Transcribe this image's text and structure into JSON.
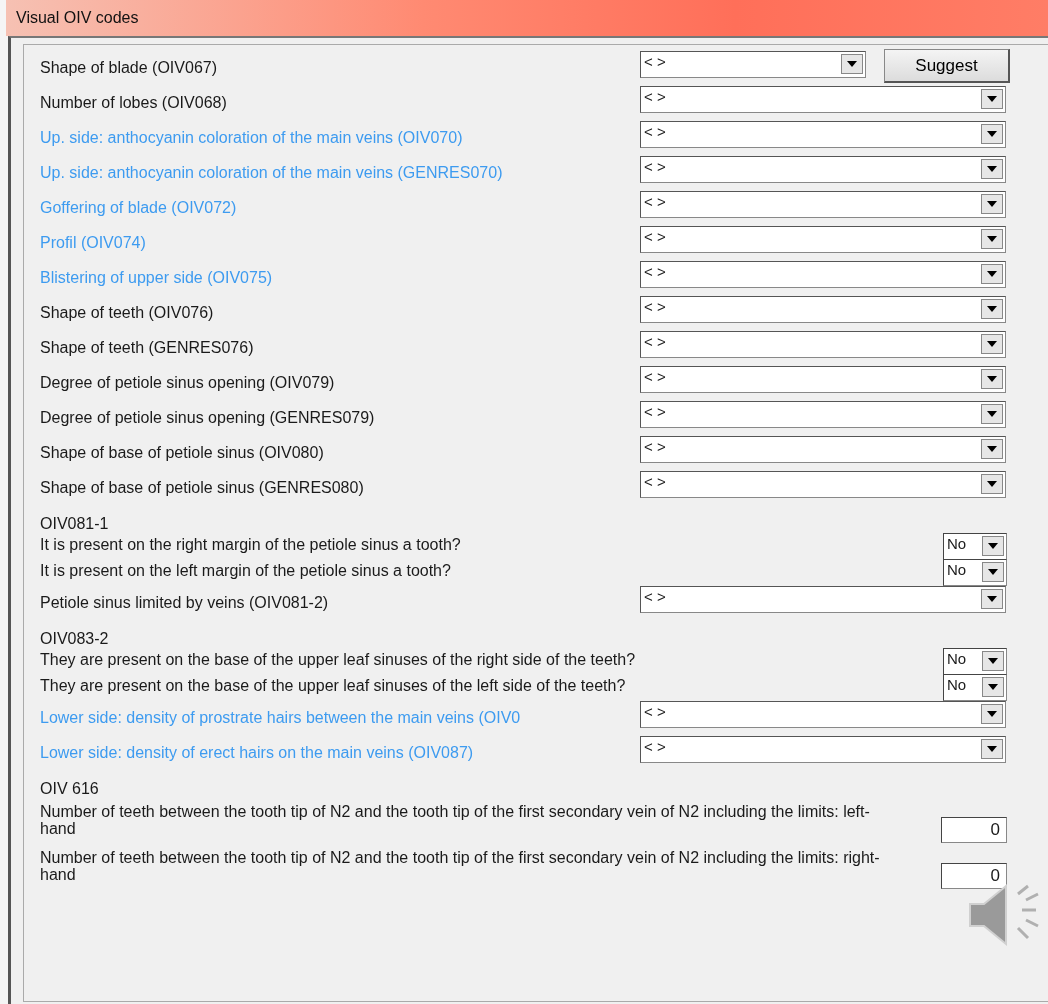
{
  "window": {
    "title": "Visual OIV codes"
  },
  "items": [
    {
      "kind": "select",
      "label": "Shape of blade (OIV067)",
      "highlighted": false,
      "value": "< >",
      "button": "Suggest"
    },
    {
      "kind": "select",
      "label": "Number of lobes (OIV068)",
      "highlighted": false,
      "value": "< >"
    },
    {
      "kind": "select",
      "label": "Up. side: anthocyanin coloration of the main veins (OIV070)",
      "highlighted": true,
      "value": "< >"
    },
    {
      "kind": "select",
      "label": "Up. side: anthocyanin coloration of the main veins (GENRES070)",
      "highlighted": true,
      "value": "< >"
    },
    {
      "kind": "select",
      "label": "Goffering of blade (OIV072)",
      "highlighted": true,
      "value": "< >"
    },
    {
      "kind": "select",
      "label": "Profil (OIV074)",
      "highlighted": true,
      "value": "< >"
    },
    {
      "kind": "select",
      "label": "Blistering of upper side (OIV075)",
      "highlighted": true,
      "value": "< >"
    },
    {
      "kind": "select",
      "label": "Shape of teeth (OIV076)",
      "highlighted": false,
      "value": "< >"
    },
    {
      "kind": "select",
      "label": "Shape of teeth (GENRES076)",
      "highlighted": false,
      "value": "< >"
    },
    {
      "kind": "select",
      "label": "Degree of petiole sinus opening (OIV079)",
      "highlighted": false,
      "value": "< >"
    },
    {
      "kind": "select",
      "label": "Degree of petiole sinus opening (GENRES079)",
      "highlighted": false,
      "value": "< >"
    },
    {
      "kind": "select",
      "label": "Shape of base of petiole sinus (OIV080)",
      "highlighted": false,
      "value": "< >"
    },
    {
      "kind": "select",
      "label": "Shape of base of petiole sinus (GENRES080)",
      "highlighted": false,
      "value": "< >"
    },
    {
      "kind": "group",
      "title": "OIV081-1",
      "questions": [
        {
          "kind": "yesno",
          "text": "It is present on the right margin of the petiole sinus a tooth?",
          "value": "No"
        },
        {
          "kind": "yesno",
          "text": "It is present on the left margin of the petiole sinus a tooth?",
          "value": "No"
        }
      ]
    },
    {
      "kind": "select",
      "label": "Petiole sinus limited by veins (OIV081-2)",
      "highlighted": false,
      "value": "< >"
    },
    {
      "kind": "group",
      "title": "OIV083-2",
      "questions": [
        {
          "kind": "yesno",
          "text": "They are present on the base of the upper leaf sinuses of the right side of the teeth?",
          "value": "No"
        },
        {
          "kind": "yesno",
          "text": "They are present on the base of the upper leaf sinuses of the left side of the teeth?",
          "value": "No"
        }
      ]
    },
    {
      "kind": "select",
      "label": "Lower side: density of prostrate hairs between the main veins (OIV0",
      "highlighted": true,
      "value": "< >"
    },
    {
      "kind": "select",
      "label": "Lower side: density of erect hairs on the main veins (OIV087)",
      "highlighted": true,
      "value": "< >"
    },
    {
      "kind": "group",
      "title": "OIV 616",
      "questions": [
        {
          "kind": "number",
          "text": "Number of teeth between the tooth tip of N2 and the tooth tip of the first secondary vein of N2 including the limits: left-hand",
          "value": "0"
        },
        {
          "kind": "number",
          "text": "Number of teeth between the tooth tip of N2 and the tooth tip of the first secondary vein of N2 including the limits: right-hand",
          "value": "0"
        }
      ]
    }
  ]
}
